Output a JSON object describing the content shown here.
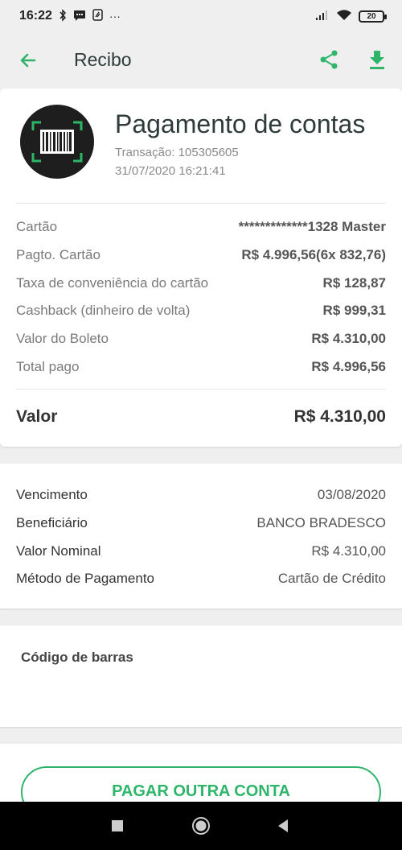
{
  "status_bar": {
    "time": "16:22",
    "left_icons": [
      "bluetooth-icon",
      "message-icon",
      "app-icon",
      "more-icon"
    ],
    "more": "···",
    "signal": "signal-icon",
    "wifi": "wifi-icon",
    "battery": "20"
  },
  "app_bar": {
    "title": "Recibo",
    "back_icon": "arrow-back-icon",
    "share_icon": "share-icon",
    "download_icon": "download-icon"
  },
  "receipt": {
    "title": "Pagamento de contas",
    "transaction": "Transação: 105305605",
    "datetime": "31/07/2020 16:21:41",
    "rows": [
      {
        "label": "Cartão",
        "value": "*************1328 Master"
      },
      {
        "label": "Pagto. Cartão",
        "value": "R$ 4.996,56(6x 832,76)"
      },
      {
        "label": "Taxa de conveniência do cartão",
        "value": "R$ 128,87"
      },
      {
        "label": "Cashback (dinheiro de volta)",
        "value": "R$ 999,31"
      },
      {
        "label": "Valor do Boleto",
        "value": "R$ 4.310,00"
      },
      {
        "label": "Total pago",
        "value": "R$ 4.996,56"
      }
    ],
    "total_label": "Valor",
    "total_value": "R$ 4.310,00"
  },
  "details": {
    "rows": [
      {
        "label": "Vencimento",
        "value": "03/08/2020"
      },
      {
        "label": "Beneficiário",
        "value": "BANCO BRADESCO"
      },
      {
        "label": "Valor Nominal",
        "value": "R$ 4.310,00"
      },
      {
        "label": "Método de Pagamento",
        "value": "Cartão de Crédito"
      }
    ]
  },
  "barcode": {
    "title": "Código de barras"
  },
  "action": {
    "pay_another": "PAGAR OUTRA CONTA"
  },
  "colors": {
    "accent": "#2eb56a",
    "background": "#efefef",
    "card": "#ffffff"
  }
}
